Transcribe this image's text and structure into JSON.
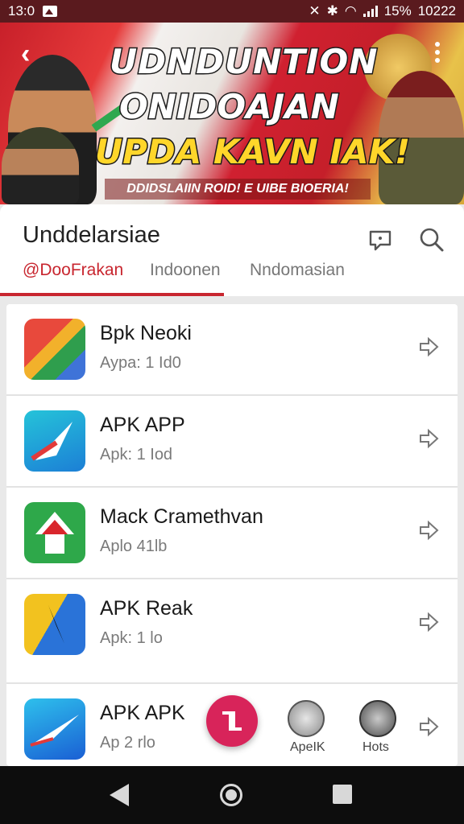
{
  "status_bar": {
    "time": "13:0",
    "battery": "15%",
    "clock": "10222"
  },
  "banner": {
    "headline_1": "UDNDUNTION",
    "headline_2": "ONIDOAJAN",
    "headline_3": "UPDA KAVN IAK!",
    "strip": "DDIDSLAIIN ROID! E UIBE BIOERIA!"
  },
  "header": {
    "title": "Unddelarsiae",
    "tabs": [
      {
        "label": "@DooFrakan",
        "active": true
      },
      {
        "label": "Indoonen",
        "active": false
      },
      {
        "label": "Nndomasian",
        "active": false
      }
    ]
  },
  "apps": [
    {
      "name": "Bpk Neoki",
      "sub": "Aypa: 1 Id0"
    },
    {
      "name": "APK APP",
      "sub": "Apk: 1 Iod"
    },
    {
      "name": "Mack Cramethvan",
      "sub": "Aplo 41lb"
    },
    {
      "name": "APK Reak",
      "sub": "Apk: 1 lo"
    },
    {
      "name": "APK APK",
      "sub": "Ap 2 rlo"
    }
  ],
  "actions": {
    "mini_1": "ApeIK",
    "mini_2": "Hots"
  },
  "colors": {
    "accent": "#c8262f",
    "fab": "#d8245a",
    "status_bar": "#5a1a1e"
  }
}
